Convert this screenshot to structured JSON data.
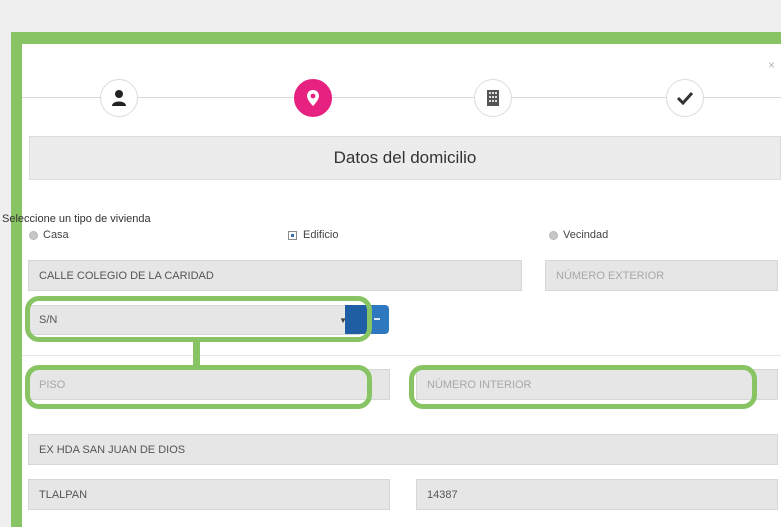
{
  "dialog": {
    "close_symbol": "×",
    "title": "Datos del domicilio"
  },
  "steps": [
    {
      "icon": "user-icon",
      "state": "done"
    },
    {
      "icon": "location-pin-icon",
      "state": "active"
    },
    {
      "icon": "building-icon",
      "state": "pending"
    },
    {
      "icon": "checkmark-icon",
      "state": "pending"
    }
  ],
  "housing": {
    "prompt": "Seleccione un tipo de vivienda",
    "options": [
      "Casa",
      "Edificio",
      "Vecindad"
    ],
    "selected": "Edificio"
  },
  "form": {
    "street_value": "CALLE COLEGIO DE LA CARIDAD",
    "exterior_placeholder": "NÚMERO EXTERIOR",
    "select_value": "S/N",
    "floor_placeholder": "PISO",
    "interior_placeholder": "NÚMERO INTERIOR",
    "colonia_value": "EX HDA SAN JUAN DE DIOS",
    "delegacion_value": "TLALPAN",
    "cp_value": "14387"
  },
  "colors": {
    "highlight": "#88c463",
    "active_step": "#e6217f",
    "button": "#2e78c0"
  }
}
